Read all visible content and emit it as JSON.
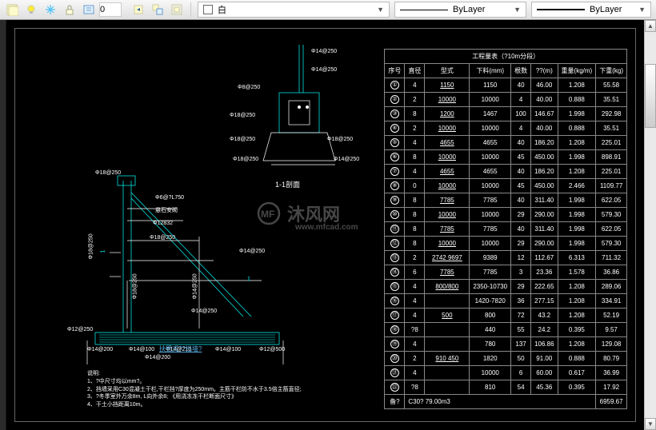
{
  "toolbar": {
    "layer_input": "0",
    "layer_dropdown": "白",
    "linetype": "ByLayer",
    "lineweight": "ByLayer"
  },
  "drawing": {
    "section_label": "1-1剖面",
    "plan_caption": "扶壁式??挡墙?",
    "rebar_callouts": {
      "c1": "Φ18@250",
      "c2": "Φ14@250",
      "c3": "Φ18@250",
      "c4": "Φ12@250",
      "c5": "Φ18@250",
      "c6": "Φ8@250",
      "c7": "Φ18@250",
      "c8": "Φ14@250",
      "c9": "Φ14@250",
      "c10": "Φ14@200",
      "c11": "Φ14@100",
      "c12": "Φ14@210",
      "c13": "Φ14@200",
      "c14": "Φ12@500",
      "c15": "Φ14@100",
      "c16": "Φ14@250",
      "c17": "Φ12832",
      "c18": "Φ6@?L750",
      "c19": "悬石安砌"
    },
    "notes": {
      "title": "说明:",
      "n1": "1、?中尺寸均以mm?。",
      "n2": "2、挡墙采用C30混凝土干栏,干栏挡?厚度为250mm。主筋干栏防不水于3.5倍主筋直径;",
      "n3": "3、?冬季室外万余8m, L向外余8; 《用浇冻冻干栏断面尺寸》",
      "n4": "4、干土小挡距离10m。"
    }
  },
  "table": {
    "title": "工程量表（?10m分段）",
    "headers": [
      "序号",
      "直径",
      "型式",
      "下料(mm)",
      "根数",
      "??(m)",
      "重量(kg/m)",
      "下重(kg)"
    ],
    "rows": [
      [
        "①",
        "4",
        "1150",
        "1150",
        "40",
        "46.00",
        "1.208",
        "55.58"
      ],
      [
        "②",
        "2",
        "10000",
        "10000",
        "4",
        "40.00",
        "0.888",
        "35.51"
      ],
      [
        "③",
        "8",
        "1200",
        "1467",
        "100",
        "146.67",
        "1.998",
        "292.98"
      ],
      [
        "④",
        "2",
        "10000",
        "10000",
        "4",
        "40.00",
        "0.888",
        "35.51"
      ],
      [
        "⑤",
        "4",
        "4655",
        "4655",
        "40",
        "186.20",
        "1.208",
        "225.01"
      ],
      [
        "⑥",
        "8",
        "10000",
        "10000",
        "45",
        "450.00",
        "1.998",
        "898.91"
      ],
      [
        "⑦",
        "4",
        "4655",
        "4655",
        "40",
        "186.20",
        "1.208",
        "225.01"
      ],
      [
        "⑧",
        "0",
        "10000",
        "10000",
        "45",
        "450.00",
        "2.466",
        "1109.77"
      ],
      [
        "⑨",
        "8",
        "7785",
        "7785",
        "40",
        "311.40",
        "1.998",
        "622.05"
      ],
      [
        "⑩",
        "8",
        "10000",
        "10000",
        "29",
        "290.00",
        "1.998",
        "579.30"
      ],
      [
        "⑪",
        "8",
        "7785",
        "7785",
        "40",
        "311.40",
        "1.998",
        "622.05"
      ],
      [
        "⑫",
        "8",
        "10000",
        "10000",
        "29",
        "290.00",
        "1.998",
        "579.30"
      ],
      [
        "⑬",
        "2",
        "2742 9697",
        "9389",
        "12",
        "112.67",
        "6.313",
        "711.32"
      ],
      [
        "⑭",
        "6",
        "7785",
        "7785",
        "3",
        "23.36",
        "1.578",
        "36.86"
      ],
      [
        "⑮",
        "4",
        "800/800",
        "2350-10730",
        "29",
        "222.65",
        "1.208",
        "289.06"
      ],
      [
        "⑯",
        "4",
        "",
        "1420-7820",
        "36",
        "277.15",
        "1.208",
        "334.91"
      ],
      [
        "⑰",
        "4",
        "500",
        "800",
        "72",
        "43.2",
        "1.208",
        "52.19"
      ],
      [
        "⑱",
        "?8",
        "",
        "440",
        "55",
        "24.2",
        "0.395",
        "9.57"
      ],
      [
        "⑲",
        "4",
        "",
        "780",
        "137",
        "106.86",
        "1.208",
        "129.08"
      ],
      [
        "⑳",
        "2",
        "910 450",
        "1820",
        "50",
        "91.00",
        "0.888",
        "80.79"
      ],
      [
        "㉑",
        "4",
        "",
        "10000",
        "6",
        "60.00",
        "0.617",
        "36.99"
      ],
      [
        "㉒",
        "?8",
        "",
        "810",
        "54",
        "45.36",
        "0.395",
        "17.92"
      ]
    ],
    "footer_label": "备?",
    "footer_conc": "C30?  79.00m3",
    "footer_total": "6959.67"
  },
  "watermark": {
    "brand": "沐风网",
    "url": "www.mfcad.com"
  }
}
